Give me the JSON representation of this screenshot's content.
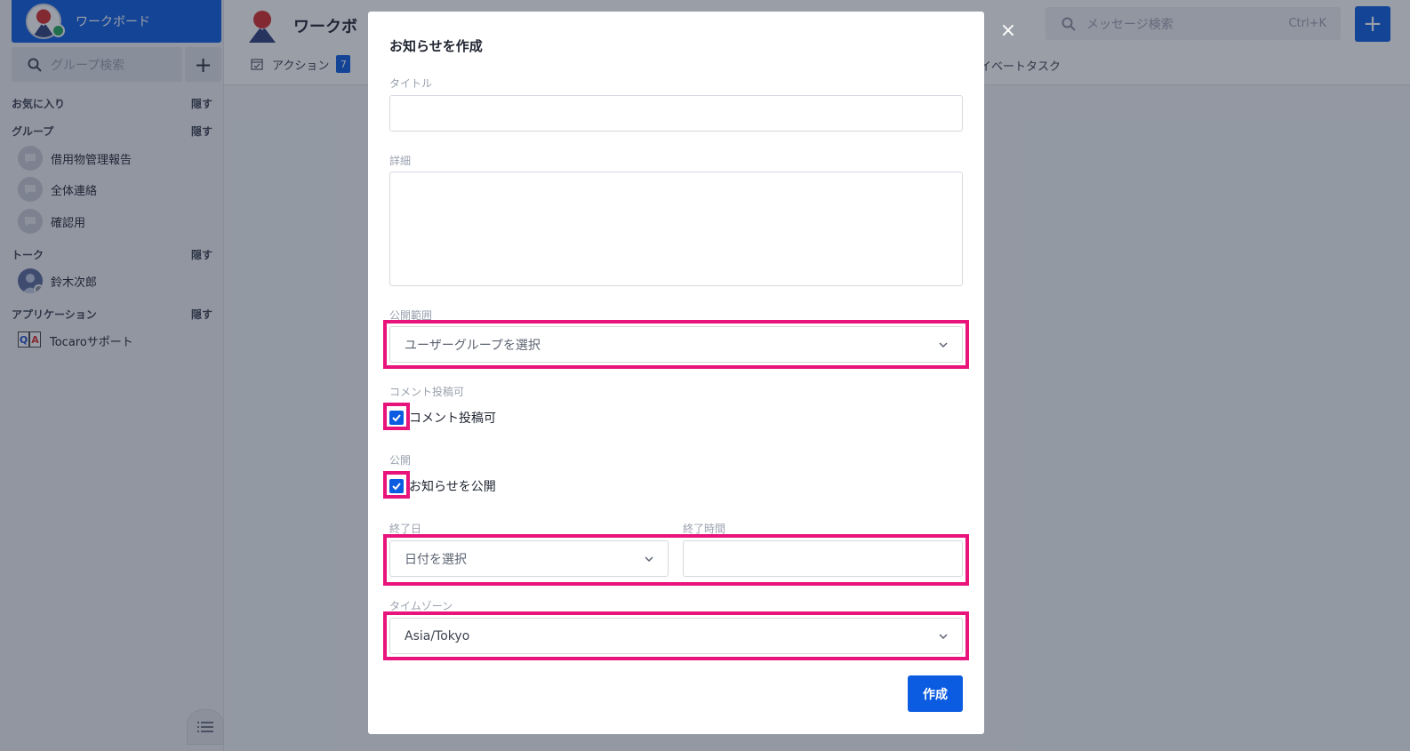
{
  "sidebar": {
    "workboard_label": "ワークボード",
    "group_search_placeholder": "グループ検索",
    "add_label": "+",
    "favorites": {
      "title": "お気に入り",
      "hide": "隠す"
    },
    "groups": {
      "title": "グループ",
      "hide": "隠す",
      "items": [
        {
          "label": "借用物管理報告"
        },
        {
          "label": "全体連絡"
        },
        {
          "label": "確認用"
        }
      ]
    },
    "talk": {
      "title": "トーク",
      "hide": "隠す",
      "items": [
        {
          "label": "鈴木次郎"
        }
      ]
    },
    "apps": {
      "title": "アプリケーション",
      "hide": "隠す",
      "items": [
        {
          "label": "Tocaroサポート"
        }
      ]
    }
  },
  "header": {
    "title": "ワークボ",
    "tab_action": {
      "label": "アクション",
      "badge": "7"
    },
    "tab_private": "イベートタスク",
    "search_placeholder": "メッセージ検索",
    "search_shortcut": "Ctrl+K",
    "new_label": "+"
  },
  "modal": {
    "title": "お知らせを作成",
    "close": "×",
    "title_field": {
      "label": "タイトル",
      "value": ""
    },
    "detail_field": {
      "label": "詳細",
      "value": ""
    },
    "scope": {
      "label": "公開範囲",
      "value": "ユーザーグループを選択"
    },
    "comment": {
      "label": "コメント投稿可",
      "checkbox_label": "コメント投稿可",
      "checked": true
    },
    "publish": {
      "label": "公開",
      "checkbox_label": "お知らせを公開",
      "checked": true
    },
    "end_date": {
      "label": "終了日",
      "value": "日付を選択"
    },
    "end_time": {
      "label": "終了時間",
      "value": ""
    },
    "timezone": {
      "label": "タイムゾーン",
      "value": "Asia/Tokyo"
    },
    "submit_label": "作成"
  },
  "colors": {
    "primary": "#0b5ce0",
    "highlight": "#e8137b",
    "online": "#21a85a"
  }
}
